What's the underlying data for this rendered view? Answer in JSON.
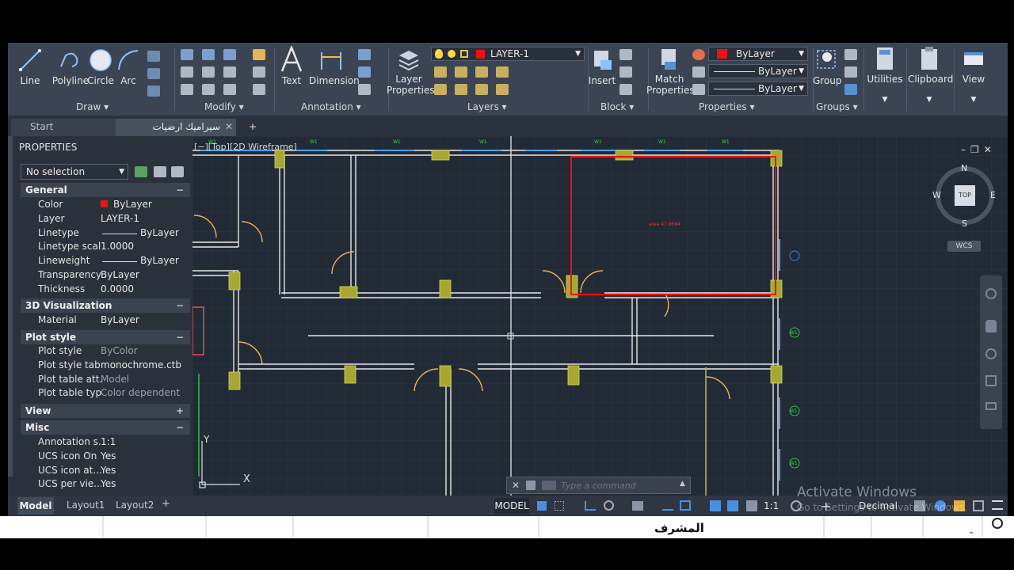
{
  "ribbon": {
    "draw": {
      "line": "Line",
      "polyline": "Polyline",
      "circle": "Circle",
      "arc": "Arc",
      "group": "Draw"
    },
    "modify": {
      "group": "Modify"
    },
    "annotation": {
      "text": "Text",
      "dimension": "Dimension",
      "group": "Annotation"
    },
    "layers": {
      "layer_properties_1": "Layer",
      "layer_properties_2": "Properties",
      "current_layer": "LAYER-1",
      "group": "Layers"
    },
    "block": {
      "insert": "Insert",
      "group": "Block"
    },
    "properties": {
      "match_1": "Match",
      "match_2": "Properties",
      "color": "ByLayer",
      "linetype": "ByLayer",
      "lineweight": "ByLayer",
      "group": "Properties"
    },
    "groups": {
      "group_tool": "Group",
      "group": "Groups"
    },
    "utilities": "Utilities",
    "clipboard": "Clipboard",
    "view": "View"
  },
  "tabs": {
    "start": "Start",
    "drawing": "سيراميك ارضيات المكاتب*",
    "plus": "+"
  },
  "palette": {
    "title": "PROPERTIES",
    "selection": "No selection",
    "sections": {
      "general": "General",
      "viz": "3D Visualization",
      "plot": "Plot style",
      "view": "View",
      "misc": "Misc"
    },
    "general": [
      {
        "k": "Color",
        "v": "ByLayer"
      },
      {
        "k": "Layer",
        "v": "LAYER-1"
      },
      {
        "k": "Linetype",
        "v": "ByLayer"
      },
      {
        "k": "Linetype scale",
        "v": "1.0000"
      },
      {
        "k": "Lineweight",
        "v": "ByLayer"
      },
      {
        "k": "Transparency",
        "v": "ByLayer"
      },
      {
        "k": "Thickness",
        "v": "0.0000"
      }
    ],
    "viz": [
      {
        "k": "Material",
        "v": "ByLayer"
      }
    ],
    "plot": [
      {
        "k": "Plot style",
        "v": "ByColor"
      },
      {
        "k": "Plot style tab...",
        "v": "monochrome.ctb"
      },
      {
        "k": "Plot table att...",
        "v": "Model"
      },
      {
        "k": "Plot table type",
        "v": "Color dependent"
      }
    ],
    "misc": [
      {
        "k": "Annotation s...",
        "v": "1:1"
      },
      {
        "k": "UCS icon On",
        "v": "Yes"
      },
      {
        "k": "UCS icon at...",
        "v": "Yes"
      },
      {
        "k": "UCS per vie...",
        "v": "Yes"
      }
    ]
  },
  "viewport": {
    "label": "[−][Top][2D Wireframe]",
    "area_text": "area 47.9684",
    "wcs": "WCS"
  },
  "viewcube": {
    "n": "N",
    "s": "S",
    "e": "E",
    "w": "W",
    "top": "TOP"
  },
  "window_tags": {
    "w2": "W2",
    "w1": "W1"
  },
  "ucs": {
    "y": "Y",
    "x": "X"
  },
  "command": {
    "placeholder": "Type a command"
  },
  "layout_tabs": {
    "model": "Model",
    "layout1": "Layout1",
    "layout2": "Layout2",
    "plus": "+"
  },
  "statusbar": {
    "model": "MODEL",
    "scale": "1:1",
    "units": "Decimal"
  },
  "watermark": {
    "line1": "Activate Windows",
    "line2": "Go to Settings to activate Windows."
  },
  "sheet": {
    "label": "المشرف"
  },
  "colors": {
    "accent_red": "#ee1111",
    "wall": "#e8e8e8",
    "column": "#a8a830",
    "canvas": "#222a35"
  }
}
